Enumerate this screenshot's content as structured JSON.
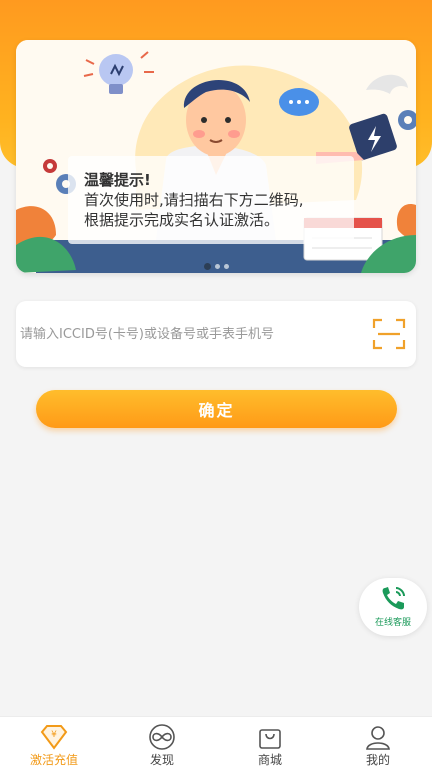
{
  "banner": {
    "tip_title": "温馨提示!",
    "tip_line1": "首次使用时,请扫描右下方二维码,",
    "tip_line2": "根据提示完成实名认证激活。",
    "carousel_total": 3,
    "carousel_active": 1
  },
  "search": {
    "placeholder": "请输入ICCID号(卡号)或设备号或手表手机号",
    "value": ""
  },
  "confirm_label": "确定",
  "service_label": "在线客服",
  "tabs": [
    {
      "label": "激活充值",
      "icon": "yuan-diamond-icon",
      "active": true
    },
    {
      "label": "发现",
      "icon": "infinity-icon",
      "active": false
    },
    {
      "label": "商城",
      "icon": "shopping-bag-icon",
      "active": false
    },
    {
      "label": "我的",
      "icon": "user-icon",
      "active": false
    }
  ],
  "colors": {
    "accent": "#ff9a1f",
    "service_green": "#1b9a5a"
  }
}
